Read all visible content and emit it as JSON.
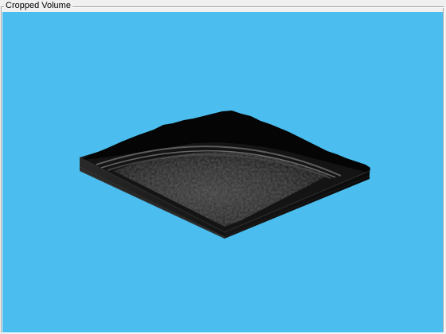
{
  "panel": {
    "title": "Cropped Volume"
  },
  "viewport": {
    "background_color": "#4bbdee",
    "volume_color": "#1a1a1a",
    "content": "cropped-volume-render"
  }
}
